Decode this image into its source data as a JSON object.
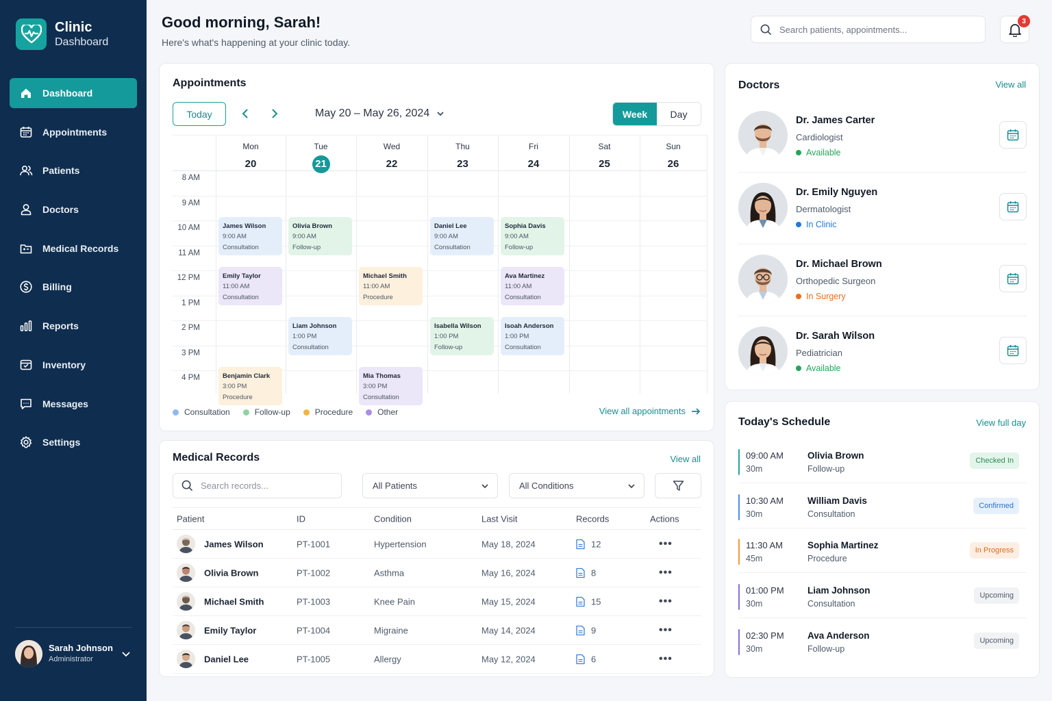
{
  "brand": {
    "title": "Clinic",
    "subtitle": "Dashboard"
  },
  "nav": [
    {
      "label": "Dashboard",
      "icon": "home-icon",
      "active": true
    },
    {
      "label": "Appointments",
      "icon": "calendar-icon"
    },
    {
      "label": "Patients",
      "icon": "users-icon"
    },
    {
      "label": "Doctors",
      "icon": "user-icon"
    },
    {
      "label": "Medical Records",
      "icon": "folder-icon"
    },
    {
      "label": "Billing",
      "icon": "dollar-icon"
    },
    {
      "label": "Reports",
      "icon": "bar-chart-icon"
    },
    {
      "label": "Inventory",
      "icon": "box-icon"
    },
    {
      "label": "Messages",
      "icon": "message-icon"
    },
    {
      "label": "Settings",
      "icon": "gear-icon"
    }
  ],
  "user": {
    "name": "Sarah Johnson",
    "role": "Administrator"
  },
  "header": {
    "greeting": "Good morning, Sarah!",
    "subtitle": "Here's what's happening at your clinic today.",
    "search_placeholder": "Search patients, appointments...",
    "notifications": "3"
  },
  "appointments": {
    "title": "Appointments",
    "today_label": "Today",
    "range": "May 20 – May 26, 2024",
    "view_week": "Week",
    "view_day": "Day",
    "days": [
      {
        "name": "Mon",
        "date": "20"
      },
      {
        "name": "Tue",
        "date": "21",
        "today": true
      },
      {
        "name": "Wed",
        "date": "22"
      },
      {
        "name": "Thu",
        "date": "23"
      },
      {
        "name": "Fri",
        "date": "24"
      },
      {
        "name": "Sat",
        "date": "25"
      },
      {
        "name": "Sun",
        "date": "26"
      }
    ],
    "times": [
      "8 AM",
      "9 AM",
      "10 AM",
      "11 AM",
      "12 PM",
      "1 PM",
      "2 PM",
      "3 PM",
      "4 PM"
    ],
    "events": [
      {
        "name": "James Wilson",
        "time": "9:00 AM",
        "type": "Consultation",
        "day": 0,
        "start": 9,
        "kind": "c"
      },
      {
        "name": "Olivia Brown",
        "time": "9:00 AM",
        "type": "Follow-up",
        "day": 1,
        "start": 9,
        "kind": "f"
      },
      {
        "name": "Daniel Lee",
        "time": "9:00 AM",
        "type": "Consultation",
        "day": 3,
        "start": 9,
        "kind": "c"
      },
      {
        "name": "Sophia Davis",
        "time": "9:00 AM",
        "type": "Follow-up",
        "day": 4,
        "start": 9,
        "kind": "f"
      },
      {
        "name": "Emily Taylor",
        "time": "11:00 AM",
        "type": "Consultation",
        "day": 0,
        "start": 11,
        "kind": "o"
      },
      {
        "name": "Michael Smith",
        "time": "11:00 AM",
        "type": "Procedure",
        "day": 2,
        "start": 11,
        "kind": "p"
      },
      {
        "name": "Ava Martinez",
        "time": "11:00 AM",
        "type": "Consultation",
        "day": 4,
        "start": 11,
        "kind": "o"
      },
      {
        "name": "Liam Johnson",
        "time": "1:00 PM",
        "type": "Consultation",
        "day": 1,
        "start": 13,
        "kind": "c"
      },
      {
        "name": "Isabella Wilson",
        "time": "1:00 PM",
        "type": "Follow-up",
        "day": 3,
        "start": 13,
        "kind": "f"
      },
      {
        "name": "Isoah Anderson",
        "time": "1:00 PM",
        "type": "Consultation",
        "day": 4,
        "start": 13,
        "kind": "c"
      },
      {
        "name": "Benjamin Clark",
        "time": "3:00 PM",
        "type": "Procedure",
        "day": 0,
        "start": 15,
        "kind": "p"
      },
      {
        "name": "Mia Thomas",
        "time": "3:00 PM",
        "type": "Consultation",
        "day": 2,
        "start": 15,
        "kind": "o"
      }
    ],
    "legend": [
      {
        "label": "Consultation",
        "color": "#8fb8f0"
      },
      {
        "label": "Follow-up",
        "color": "#8fd3a4"
      },
      {
        "label": "Procedure",
        "color": "#f2b544"
      },
      {
        "label": "Other",
        "color": "#a88ee4"
      }
    ],
    "view_all": "View all appointments"
  },
  "records": {
    "title": "Medical Records",
    "view_all": "View all",
    "search_placeholder": "Search records...",
    "filter_patients": "All Patients",
    "filter_conditions": "All Conditions",
    "columns": [
      "Patient",
      "ID",
      "Condition",
      "Last Visit",
      "Records",
      "Actions"
    ],
    "rows": [
      {
        "patient": "James Wilson",
        "id": "PT-1001",
        "condition": "Hypertension",
        "last_visit": "May 18, 2024",
        "records": "12"
      },
      {
        "patient": "Olivia Brown",
        "id": "PT-1002",
        "condition": "Asthma",
        "last_visit": "May 16, 2024",
        "records": "8"
      },
      {
        "patient": "Michael Smith",
        "id": "PT-1003",
        "condition": "Knee Pain",
        "last_visit": "May 15, 2024",
        "records": "15"
      },
      {
        "patient": "Emily Taylor",
        "id": "PT-1004",
        "condition": "Migraine",
        "last_visit": "May 14, 2024",
        "records": "9"
      },
      {
        "patient": "Daniel Lee",
        "id": "PT-1005",
        "condition": "Allergy",
        "last_visit": "May 12, 2024",
        "records": "6"
      }
    ]
  },
  "doctors": {
    "title": "Doctors",
    "view_all": "View all",
    "items": [
      {
        "name": "Dr. James Carter",
        "specialty": "Cardiologist",
        "status": "Available",
        "status_color": "#22a55a"
      },
      {
        "name": "Dr. Emily Nguyen",
        "specialty": "Dermatologist",
        "status": "In Clinic",
        "status_color": "#1e7be0"
      },
      {
        "name": "Dr. Michael Brown",
        "specialty": "Orthopedic Surgeon",
        "status": "In Surgery",
        "status_color": "#ef6c1a"
      },
      {
        "name": "Dr. Sarah Wilson",
        "specialty": "Pediatrician",
        "status": "Available",
        "status_color": "#22a55a"
      }
    ]
  },
  "schedule": {
    "title": "Today's Schedule",
    "view_full": "View full day",
    "items": [
      {
        "time": "09:00 AM",
        "duration": "30m",
        "name": "Olivia Brown",
        "type": "Follow-up",
        "status": "Checked In",
        "bar": "#26a69a",
        "bg": "#e3f5ea",
        "fg": "#2e8b57"
      },
      {
        "time": "10:30 AM",
        "duration": "30m",
        "name": "William Davis",
        "type": "Consultation",
        "status": "Confirmed",
        "bar": "#4a8fe7",
        "bg": "#e6f0fc",
        "fg": "#2a72c9"
      },
      {
        "time": "11:30 AM",
        "duration": "45m",
        "name": "Sophia Martinez",
        "type": "Procedure",
        "status": "In Progress",
        "bar": "#f29a38",
        "bg": "#fdeee3",
        "fg": "#e56a1c"
      },
      {
        "time": "01:00 PM",
        "duration": "30m",
        "name": "Liam Johnson",
        "type": "Consultation",
        "status": "Upcoming",
        "bar": "#8a6fd8",
        "bg": "#f1f2f4",
        "fg": "#4e5a6a"
      },
      {
        "time": "02:30 PM",
        "duration": "30m",
        "name": "Ava Anderson",
        "type": "Follow-up",
        "status": "Upcoming",
        "bar": "#8a6fd8",
        "bg": "#f1f2f4",
        "fg": "#4e5a6a"
      }
    ]
  }
}
